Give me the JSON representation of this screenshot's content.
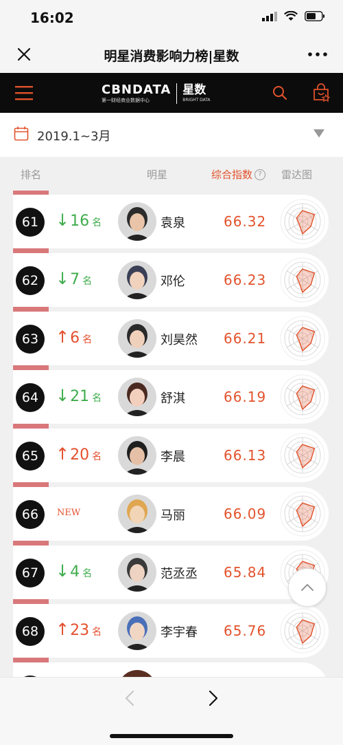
{
  "status": {
    "time": "16:02"
  },
  "wechat": {
    "title": "明星消费影响力榜|星数"
  },
  "header": {
    "brand": "CBNDATA",
    "brand_sub": "第一财经商业数据中心",
    "product": "星数",
    "product_en": "BRIGHT DATA"
  },
  "filter": {
    "date": "2019.1~3月"
  },
  "columns": {
    "rank": "排名",
    "star": "明星",
    "index": "综合指数",
    "help": "?",
    "radar": "雷达图"
  },
  "colors": {
    "accent": "#e2522b",
    "down": "#3fac4c",
    "rank_bar": "#d9787a"
  },
  "rows": [
    {
      "rank": "61",
      "dir": "down",
      "arrow": "↓",
      "change": "16",
      "unit": "名",
      "name": "袁泉",
      "score": "66.32"
    },
    {
      "rank": "62",
      "dir": "down",
      "arrow": "↓",
      "change": "7",
      "unit": "名",
      "name": "邓伦",
      "score": "66.23"
    },
    {
      "rank": "63",
      "dir": "up",
      "arrow": "↑",
      "change": "6",
      "unit": "名",
      "name": "刘昊然",
      "score": "66.21"
    },
    {
      "rank": "64",
      "dir": "down",
      "arrow": "↓",
      "change": "21",
      "unit": "名",
      "name": "舒淇",
      "score": "66.19"
    },
    {
      "rank": "65",
      "dir": "up",
      "arrow": "↑",
      "change": "20",
      "unit": "名",
      "name": "李晨",
      "score": "66.13"
    },
    {
      "rank": "66",
      "dir": "new",
      "new_label": "NEW",
      "name": "马丽",
      "score": "66.09"
    },
    {
      "rank": "67",
      "dir": "down",
      "arrow": "↓",
      "change": "4",
      "unit": "名",
      "name": "范丞丞",
      "score": "65.84"
    },
    {
      "rank": "68",
      "dir": "up",
      "arrow": "↑",
      "change": "23",
      "unit": "名",
      "name": "李宇春",
      "score": "65.76"
    }
  ],
  "icons": {
    "close": "close-icon",
    "more": "more-icon",
    "menu": "menu-icon",
    "search": "search-icon",
    "cart": "cart-icon",
    "calendar": "calendar-icon",
    "scroll_top": "chevron-up-icon",
    "back": "chevron-left-icon",
    "forward": "chevron-right-icon"
  }
}
